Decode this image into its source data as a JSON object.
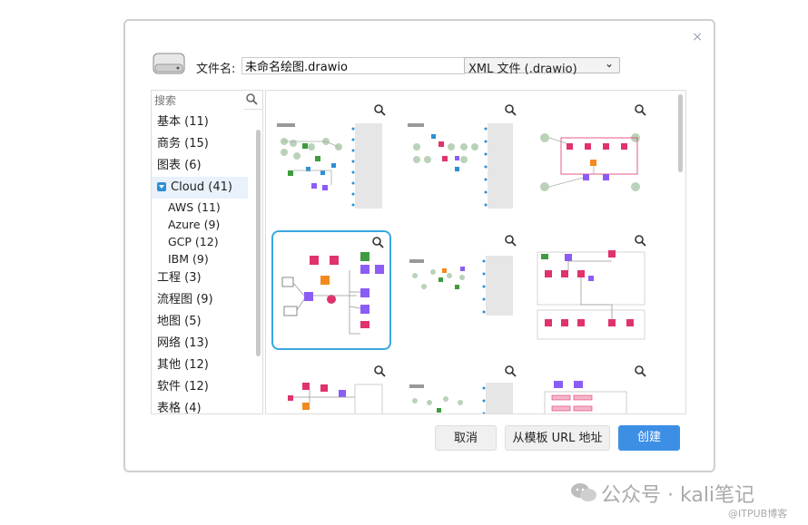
{
  "dialog": {
    "close_glyph": "×",
    "filename_label": "文件名:",
    "filename_value": "未命名绘图.drawio",
    "format_selected": "XML 文件 (.drawio)"
  },
  "search": {
    "placeholder": "搜索"
  },
  "categories": [
    {
      "label": "基本 (11)"
    },
    {
      "label": "商务 (15)"
    },
    {
      "label": "图表 (6)"
    },
    {
      "label": "Cloud (41)",
      "selected": true
    },
    {
      "label": "工程 (3)"
    },
    {
      "label": "流程图 (9)"
    },
    {
      "label": "地图 (5)"
    },
    {
      "label": "网络 (13)"
    },
    {
      "label": "其他 (12)"
    },
    {
      "label": "软件 (12)"
    },
    {
      "label": "表格 (4)"
    }
  ],
  "subcategories": [
    "AWS (11)",
    "Azure (9)",
    "GCP (12)",
    "IBM (9)"
  ],
  "buttons": {
    "cancel": "取消",
    "from_url": "从模板 URL 地址",
    "create": "创建"
  },
  "watermark": {
    "main": "公众号 · kali笔记",
    "sub": "@ITPUB博客"
  },
  "colors": {
    "accent": "#3d8fe6",
    "selected_border": "#3aa8e0",
    "aws_pink": "#e0336b",
    "aws_purple": "#8b5cf6",
    "aws_orange": "#f28a1f",
    "aws_green": "#3f9b3f"
  }
}
